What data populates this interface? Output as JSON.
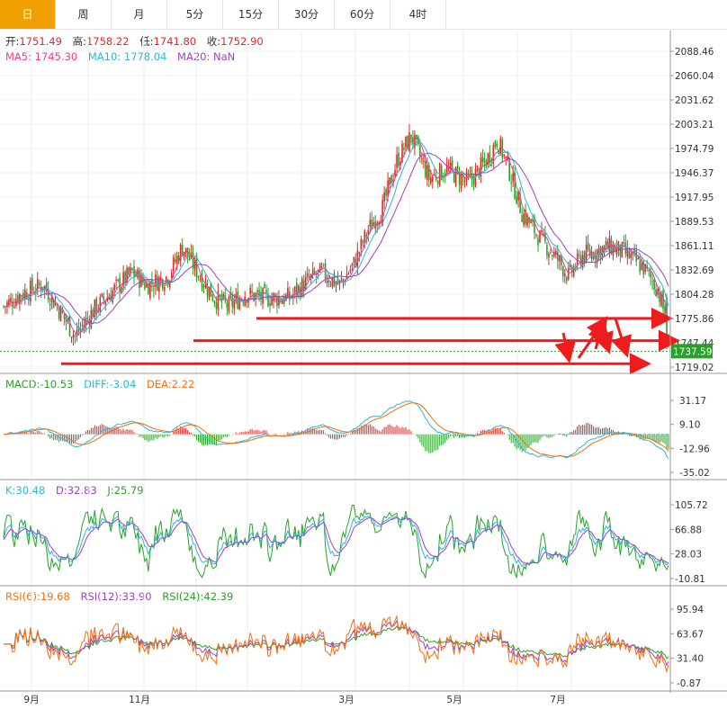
{
  "tabs": [
    "日",
    "周",
    "月",
    "5分",
    "15分",
    "30分",
    "60分",
    "4时"
  ],
  "active_tab": "日",
  "ohlc_legend": {
    "open_label": "开:",
    "open": "1751.49",
    "high_label": "高:",
    "high": "1758.22",
    "low_label": "低:",
    "low": "1741.80",
    "close_label": "收:",
    "close": "1752.90"
  },
  "ma_legend": {
    "ma5_label": "MA5:",
    "ma5": "1745.30",
    "ma10_label": "MA10:",
    "ma10": "1778.04",
    "ma20_label": "MA20:",
    "ma20": "NaN"
  },
  "macd_legend": {
    "macd_label": "MACD:",
    "macd": "-10.53",
    "diff_label": "DIFF:",
    "diff": "-3.04",
    "dea_label": "DEA:",
    "dea": "2.22"
  },
  "kdj_legend": {
    "k_label": "K:",
    "k": "30.48",
    "d_label": "D:",
    "d": "32.83",
    "j_label": "J:",
    "j": "25.79"
  },
  "rsi_legend": {
    "rsi6_label": "RSI(6):",
    "rsi6": "19.68",
    "rsi12_label": "RSI(12):",
    "rsi12": "33.90",
    "rsi24_label": "RSI(24):",
    "rsi24": "42.39"
  },
  "current_price_tag": "1737.59",
  "colors": {
    "up": "#e0292a",
    "down": "#2aa02a",
    "ma5": "#ef3b8a",
    "ma10": "#2db7d4",
    "ma20": "#a040c0",
    "active": "#f0a000",
    "arrow": "#ee1c1c"
  },
  "chart_data": [
    {
      "type": "candlestick",
      "y_ticks": [
        "2088.46",
        "2060.04",
        "2031.62",
        "2003.21",
        "1974.79",
        "1946.37",
        "1917.95",
        "1889.53",
        "1861.11",
        "1832.69",
        "1804.28",
        "1775.86",
        "1747.44",
        "1719.02"
      ],
      "ylim": [
        1719.02,
        2088.46
      ],
      "x_ticks": [
        "9月",
        "11月",
        "3月",
        "5月",
        "7月"
      ],
      "series_keyframes": [
        [
          0,
          1790
        ],
        [
          10,
          1805
        ],
        [
          22,
          1815
        ],
        [
          30,
          1790
        ],
        [
          40,
          1755
        ],
        [
          50,
          1785
        ],
        [
          62,
          1810
        ],
        [
          72,
          1830
        ],
        [
          80,
          1815
        ],
        [
          92,
          1825
        ],
        [
          100,
          1860
        ],
        [
          110,
          1825
        ],
        [
          118,
          1800
        ],
        [
          126,
          1790
        ],
        [
          135,
          1805
        ],
        [
          145,
          1800
        ],
        [
          160,
          1800
        ],
        [
          170,
          1820
        ],
        [
          178,
          1830
        ],
        [
          188,
          1815
        ],
        [
          196,
          1840
        ],
        [
          204,
          1880
        ],
        [
          212,
          1905
        ],
        [
          220,
          1960
        ],
        [
          228,
          1990
        ],
        [
          238,
          1940
        ],
        [
          248,
          1950
        ],
        [
          260,
          1935
        ],
        [
          270,
          1960
        ],
        [
          276,
          1985
        ],
        [
          282,
          1955
        ],
        [
          290,
          1900
        ],
        [
          300,
          1870
        ],
        [
          310,
          1845
        ],
        [
          316,
          1825
        ],
        [
          324,
          1850
        ],
        [
          332,
          1855
        ],
        [
          340,
          1860
        ],
        [
          348,
          1852
        ],
        [
          358,
          1835
        ],
        [
          366,
          1810
        ],
        [
          370,
          1780
        ],
        [
          372,
          1752.9
        ]
      ]
    },
    {
      "type": "macd",
      "y_ticks": [
        "31.17",
        "9.10",
        "-12.96",
        "-35.02"
      ],
      "ylim": [
        -35.02,
        31.17
      ]
    },
    {
      "type": "kdj",
      "y_ticks": [
        "105.72",
        "66.88",
        "28.03",
        "-10.81"
      ],
      "ylim": [
        -10.81,
        105.72
      ]
    },
    {
      "type": "rsi",
      "y_ticks": [
        "95.94",
        "63.67",
        "31.40",
        "-0.87"
      ],
      "ylim": [
        -0.87,
        95.94
      ]
    }
  ],
  "annotation_levels": [
    1776,
    1750,
    1723
  ]
}
